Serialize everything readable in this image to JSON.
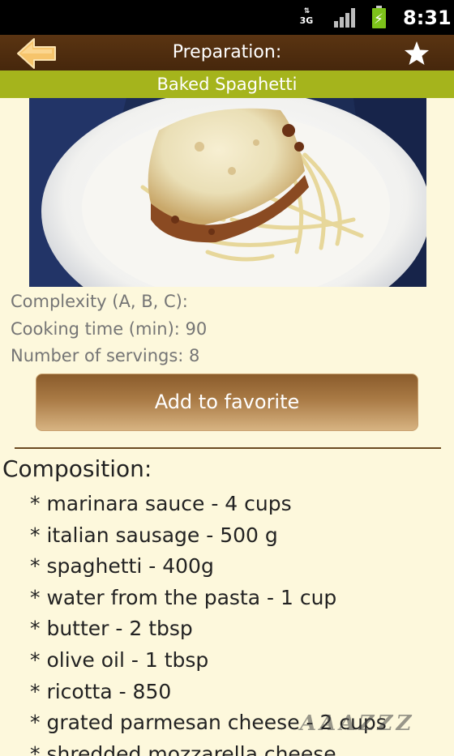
{
  "status_bar": {
    "network": "3G",
    "time": "8:31",
    "icons": [
      "data-activity-icon",
      "signal-icon",
      "battery-charging-icon"
    ]
  },
  "app_bar": {
    "back_icon": "back-arrow-icon",
    "title": "Preparation:",
    "favorite_icon": "star-icon"
  },
  "recipe": {
    "name": "Baked Spaghetti",
    "image": "baked-spaghetti-photo",
    "complexity_label": "Complexity (A, B, C):",
    "cooking_time_label": "Cooking time (min): 90",
    "servings_label": "Number of servings: 8"
  },
  "actions": {
    "add_favorite_label": "Add to favorite"
  },
  "composition": {
    "heading": "Composition:",
    "items": [
      "* marinara sauce - 4 cups",
      "* italian sausage - 500 g",
      "* spaghetti - 400g",
      "* water from the pasta - 1 cup",
      "* butter - 2 tbsp",
      "* olive oil - 1 tbsp",
      "* ricotta - 850",
      "* grated parmesan cheese - 2 cups",
      "* shredded mozzarella cheese"
    ]
  },
  "watermark": {
    "text": "AAAZZZ"
  },
  "colors": {
    "app_bar": "#4f2e10",
    "subtitle_bar": "#a5b41c",
    "background": "#fdf8dc",
    "button": "#a97a45",
    "accent_arrow": "#f6c46b"
  }
}
